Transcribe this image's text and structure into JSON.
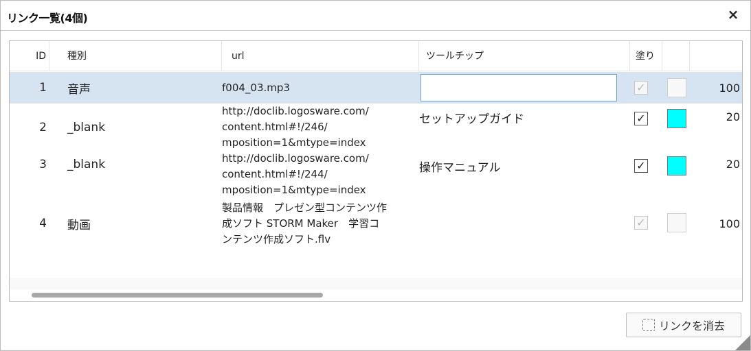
{
  "dialog": {
    "title": "リンク一覧(4個)",
    "close_label": "×",
    "clear_button_label": "リンクを消去"
  },
  "table": {
    "columns": [
      "ID",
      "種別",
      "url",
      "ツールチップ",
      "塗り",
      ""
    ],
    "rows": [
      {
        "id": "1",
        "kind": "音声",
        "url": "f004_03.mp3",
        "tooltip": "",
        "checked": true,
        "check_enabled": false,
        "color": "",
        "value": "100"
      },
      {
        "id": "2",
        "kind": "_blank",
        "url": "http://doclib.logosware.com/\ncontent.html#!/246/\nmposition=1&mtype=index",
        "tooltip": "セットアップガイド",
        "checked": true,
        "check_enabled": true,
        "color": "#00ffff",
        "value": "20"
      },
      {
        "id": "3",
        "kind": "_blank",
        "url": "http://doclib.logosware.com/\ncontent.html#!/244/\nmposition=1&mtype=index",
        "tooltip": "操作マニュアル",
        "checked": true,
        "check_enabled": true,
        "color": "#00ffff",
        "value": "20"
      },
      {
        "id": "4",
        "kind": "動画",
        "url": "製品情報　プレゼン型コンテンツ作\n成ソフト STORM Maker　学習コ\nンテンツ作成ソフト.flv",
        "tooltip": "",
        "checked": true,
        "check_enabled": false,
        "color": "",
        "value": "100"
      }
    ]
  },
  "icons": {
    "close": "close-icon",
    "clear": "clear-selection-icon",
    "check": "check-icon"
  },
  "colors": {
    "selected_row": "#d6e4f2",
    "fill_cyan": "#00ffff",
    "input_border": "#6aa3d8"
  }
}
